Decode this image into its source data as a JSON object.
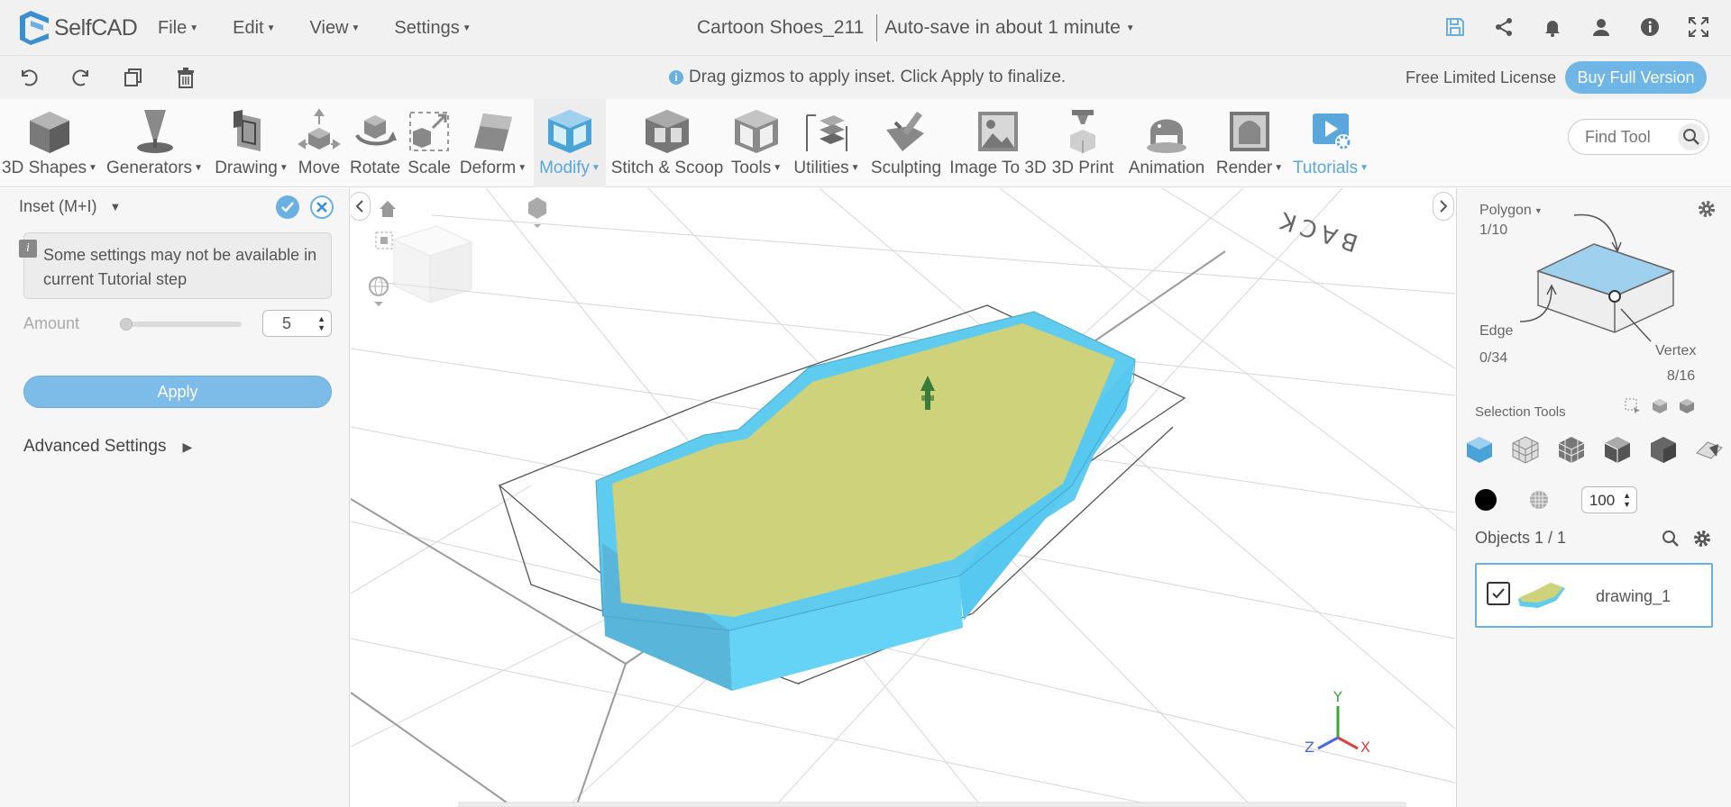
{
  "app": {
    "name": "SelfCAD",
    "menu": [
      {
        "label": "File"
      },
      {
        "label": "Edit"
      },
      {
        "label": "View"
      },
      {
        "label": "Settings"
      }
    ],
    "document_title": "Cartoon Shoes_211",
    "autosave": "Auto-save in about 1 minute"
  },
  "subbar": {
    "hint": "Drag gizmos to apply inset. Click Apply to finalize.",
    "license": "Free Limited License",
    "buy_label": "Buy Full Version"
  },
  "toolbar": {
    "tools": [
      {
        "label": "3D Shapes",
        "dropdown": true
      },
      {
        "label": "Generators",
        "dropdown": true
      },
      {
        "label": "Drawing",
        "dropdown": true
      },
      {
        "label": "Move",
        "dropdown": false
      },
      {
        "label": "Rotate",
        "dropdown": false
      },
      {
        "label": "Scale",
        "dropdown": false
      },
      {
        "label": "Deform",
        "dropdown": true
      },
      {
        "label": "Modify",
        "dropdown": true,
        "active": true
      },
      {
        "label": "Stitch & Scoop",
        "dropdown": false
      },
      {
        "label": "Tools",
        "dropdown": true
      },
      {
        "label": "Utilities",
        "dropdown": true
      },
      {
        "label": "Sculpting",
        "dropdown": false
      },
      {
        "label": "Image To 3D",
        "dropdown": false
      },
      {
        "label": "3D Print",
        "dropdown": false
      },
      {
        "label": "Animation",
        "dropdown": false
      },
      {
        "label": "Render",
        "dropdown": true
      },
      {
        "label": "Tutorials",
        "dropdown": true
      }
    ],
    "find_placeholder": "Find Tool"
  },
  "left_panel": {
    "title": "Inset (M+I)",
    "notice": "Some settings may not be available in current Tutorial step",
    "amount_label": "Amount",
    "amount_value": "5",
    "apply_label": "Apply",
    "advanced_label": "Advanced Settings"
  },
  "viewport": {
    "back_label": "BACK",
    "axes": {
      "x": "X",
      "y": "Y",
      "z": "Z"
    }
  },
  "right_panel": {
    "polygon_label": "Polygon",
    "polygon_count": "1/10",
    "edge_label": "Edge",
    "edge_count": "0/34",
    "vertex_label": "Vertex",
    "vertex_count": "8/16",
    "selection_tools_label": "Selection Tools",
    "opacity_value": "100",
    "objects_label": "Objects 1 / 1",
    "objects": [
      {
        "name": "drawing_1",
        "checked": true
      }
    ]
  },
  "colors": {
    "accent": "#5aa7dc",
    "shape_blue": "#66d4f5",
    "shape_top": "#cdd07a"
  }
}
